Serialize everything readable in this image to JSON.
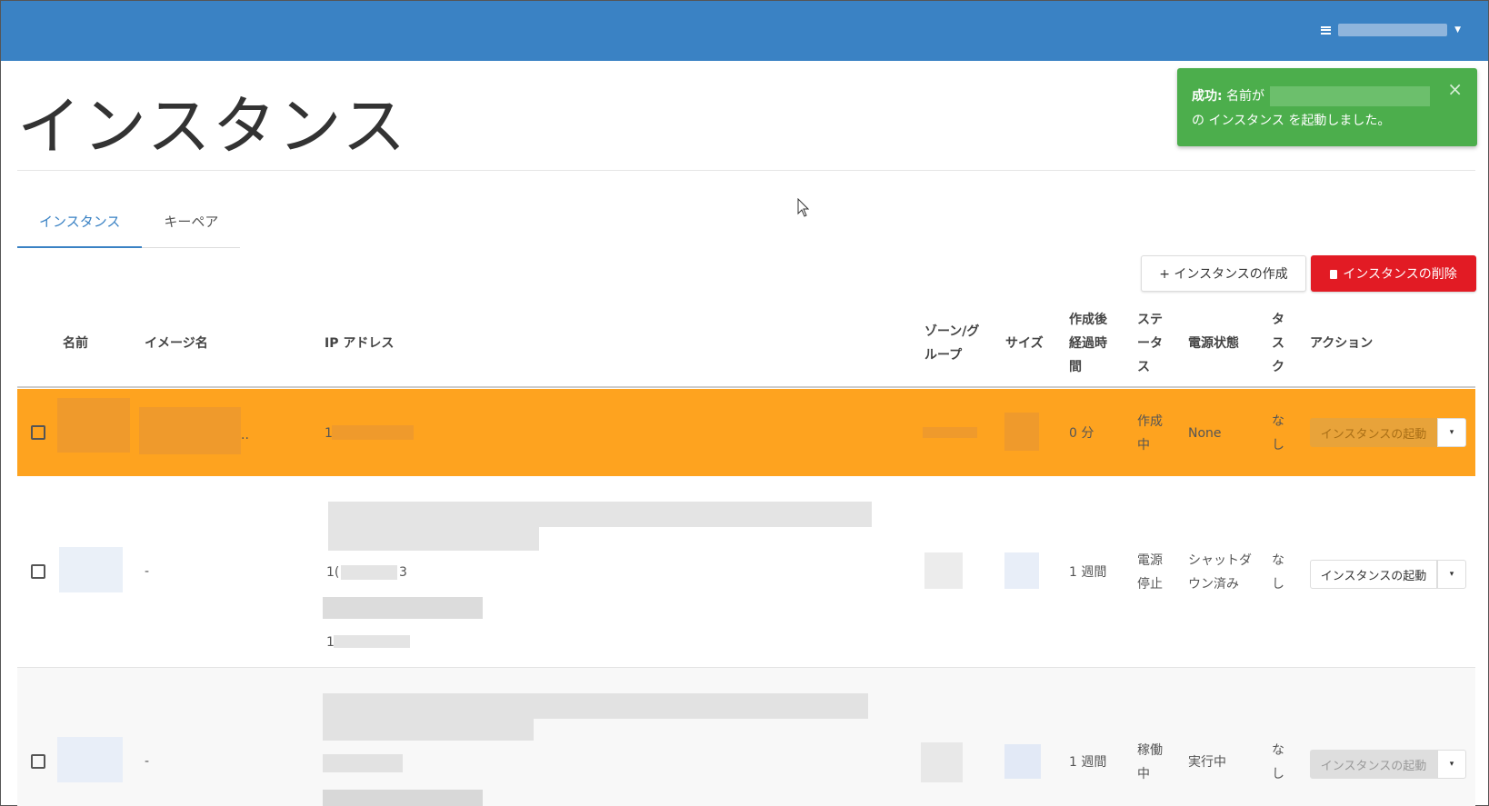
{
  "page": {
    "title": "インスタンス"
  },
  "toast": {
    "prefix": "成功:",
    "line1": " 名前が",
    "line2": "の インスタンス を起動しました。",
    "close": "×"
  },
  "tabs": [
    {
      "label": "インスタンス"
    },
    {
      "label": "キーペア"
    }
  ],
  "toolbar": {
    "create_label": "+ インスタンスの作成",
    "delete_label": "インスタンスの削除"
  },
  "table": {
    "headers": {
      "name": "名前",
      "image": "イメージ名",
      "ip": "IP アドレス",
      "zone_1": "ゾーン/グ",
      "zone_2": "ループ",
      "size": "サイズ",
      "age_1": "作成後",
      "age_2": "経過時",
      "age_3": "間",
      "status_1": "ステ",
      "status_2": "ータ",
      "status_3": "ス",
      "power": "電源状態",
      "task_1": "タ",
      "task_2": "ス",
      "task_3": "ク",
      "action": "アクション"
    },
    "rows": [
      {
        "image": "..",
        "ip": "1",
        "age": "0 分",
        "status_1": "作成",
        "status_2": "中",
        "power": "None",
        "task_1": "な",
        "task_2": "し",
        "action": "インスタンスの起動",
        "caret": "▾"
      },
      {
        "image": "-",
        "ip_a": "1(",
        "ip_b": "3",
        "ip_c": "1",
        "age": "1 週間",
        "status_1": "電源",
        "status_2": "停止",
        "power_1": "シャットダ",
        "power_2": "ウン済み",
        "task_1": "な",
        "task_2": "し",
        "action": "インスタンスの起動",
        "caret": "▾"
      },
      {
        "image": "-",
        "age": "1 週間",
        "status_1": "稼働",
        "status_2": "中",
        "power": "実行中",
        "task_1": "な",
        "task_2": "し",
        "action": "インスタンスの起動",
        "caret": "▾"
      }
    ]
  }
}
